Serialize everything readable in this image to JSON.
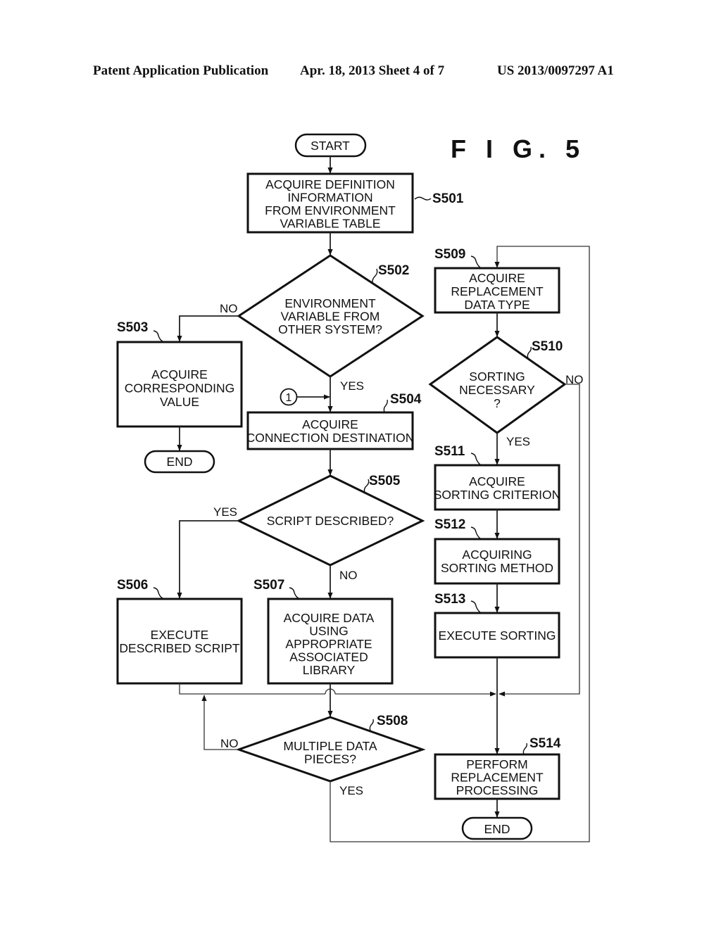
{
  "header": {
    "publication": "Patent Application Publication",
    "date_sheet": "Apr. 18, 2013  Sheet 4 of 7",
    "patent_number": "US 2013/0097297 A1"
  },
  "figure": {
    "title": "F I G.  5"
  },
  "nodes": {
    "start": {
      "text": "START"
    },
    "s501": {
      "label": "S501",
      "lines": [
        "ACQUIRE DEFINITION",
        "INFORMATION",
        "FROM ENVIRONMENT",
        "VARIABLE TABLE"
      ]
    },
    "s502": {
      "label": "S502",
      "lines": [
        "ENVIRONMENT",
        "VARIABLE FROM",
        "OTHER SYSTEM?"
      ]
    },
    "s503": {
      "label": "S503",
      "lines": [
        "ACQUIRE",
        "CORRESPONDING",
        "VALUE"
      ]
    },
    "end1": {
      "text": "END"
    },
    "s504": {
      "label": "S504",
      "lines": [
        "ACQUIRE",
        "CONNECTION DESTINATION"
      ]
    },
    "connector": {
      "text": "1"
    },
    "s505": {
      "label": "S505",
      "lines": [
        "SCRIPT DESCRIBED?"
      ]
    },
    "s506": {
      "label": "S506",
      "lines": [
        "EXECUTE",
        "DESCRIBED SCRIPT"
      ]
    },
    "s507": {
      "label": "S507",
      "lines": [
        "ACQUIRE DATA",
        "USING",
        "APPROPRIATE",
        "ASSOCIATED",
        "LIBRARY"
      ]
    },
    "s508": {
      "label": "S508",
      "lines": [
        "MULTIPLE DATA",
        "PIECES?"
      ]
    },
    "s509": {
      "label": "S509",
      "lines": [
        "ACQUIRE",
        "REPLACEMENT",
        "DATA TYPE"
      ]
    },
    "s510": {
      "label": "S510",
      "lines": [
        "SORTING",
        "NECESSARY",
        "?"
      ]
    },
    "s511": {
      "label": "S511",
      "lines": [
        "ACQUIRE",
        "SORTING CRITERION"
      ]
    },
    "s512": {
      "label": "S512",
      "lines": [
        "ACQUIRING",
        "SORTING METHOD"
      ]
    },
    "s513": {
      "label": "S513",
      "lines": [
        "EXECUTE SORTING"
      ]
    },
    "s514": {
      "label": "S514",
      "lines": [
        "PERFORM",
        "REPLACEMENT",
        "PROCESSING"
      ]
    },
    "end2": {
      "text": "END"
    }
  },
  "branches": {
    "s502_no": "NO",
    "s502_yes": "YES",
    "s505_yes": "YES",
    "s505_no": "NO",
    "s508_no": "NO",
    "s508_yes": "YES",
    "s510_no": "NO",
    "s510_yes": "YES"
  }
}
